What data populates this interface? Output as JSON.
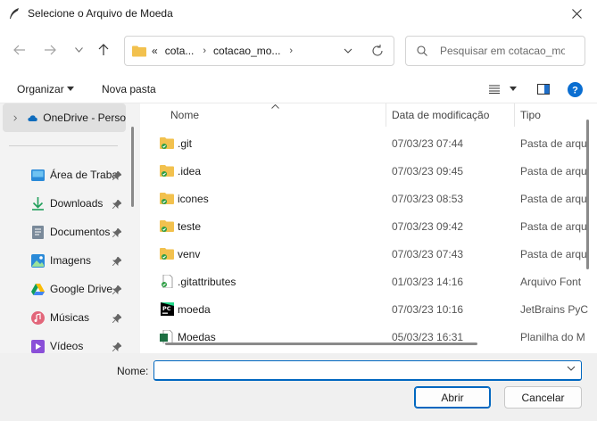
{
  "window": {
    "title": "Selecione o Arquivo de Moeda"
  },
  "address": {
    "overflow": "«",
    "crumbs": [
      "cota...",
      "cotacao_mo..."
    ],
    "search_placeholder": "Pesquisar em cotacao_moeda"
  },
  "commands": {
    "organize": "Organizar",
    "new_folder": "Nova pasta"
  },
  "nav": {
    "items": [
      {
        "label": "OneDrive - Perso",
        "icon": "cloud-icon"
      },
      {
        "label": "Área de Traba",
        "icon": "desktop-icon"
      },
      {
        "label": "Downloads",
        "icon": "download-icon"
      },
      {
        "label": "Documentos",
        "icon": "document-icon"
      },
      {
        "label": "Imagens",
        "icon": "image-icon"
      },
      {
        "label": "Google Drive",
        "icon": "google-drive-icon"
      },
      {
        "label": "Músicas",
        "icon": "music-icon"
      },
      {
        "label": "Vídeos",
        "icon": "video-icon"
      }
    ]
  },
  "columns": {
    "name": "Nome",
    "date": "Data de modificação",
    "type": "Tipo"
  },
  "files": [
    {
      "name": ".git",
      "date": "07/03/23 07:44",
      "type": "Pasta de arqu",
      "kind": "folder"
    },
    {
      "name": ".idea",
      "date": "07/03/23 09:45",
      "type": "Pasta de arqu",
      "kind": "folder"
    },
    {
      "name": "icones",
      "date": "07/03/23 08:53",
      "type": "Pasta de arqu",
      "kind": "folder"
    },
    {
      "name": "teste",
      "date": "07/03/23 09:42",
      "type": "Pasta de arqu",
      "kind": "folder"
    },
    {
      "name": "venv",
      "date": "07/03/23 07:43",
      "type": "Pasta de arqu",
      "kind": "folder"
    },
    {
      "name": ".gitattributes",
      "date": "01/03/23 14:16",
      "type": "Arquivo Font",
      "kind": "file"
    },
    {
      "name": "moeda",
      "date": "07/03/23 10:16",
      "type": "JetBrains PyC",
      "kind": "pycharm"
    },
    {
      "name": "Moedas",
      "date": "05/03/23 16:31",
      "type": "Planilha do M",
      "kind": "excel"
    }
  ],
  "footer": {
    "name_label": "Nome:",
    "name_value": "",
    "open_label": "Abrir",
    "cancel_label": "Cancelar"
  },
  "colors": {
    "accent": "#0067c0",
    "folder": "#f2c14e",
    "sync_green": "#2e9e44"
  }
}
